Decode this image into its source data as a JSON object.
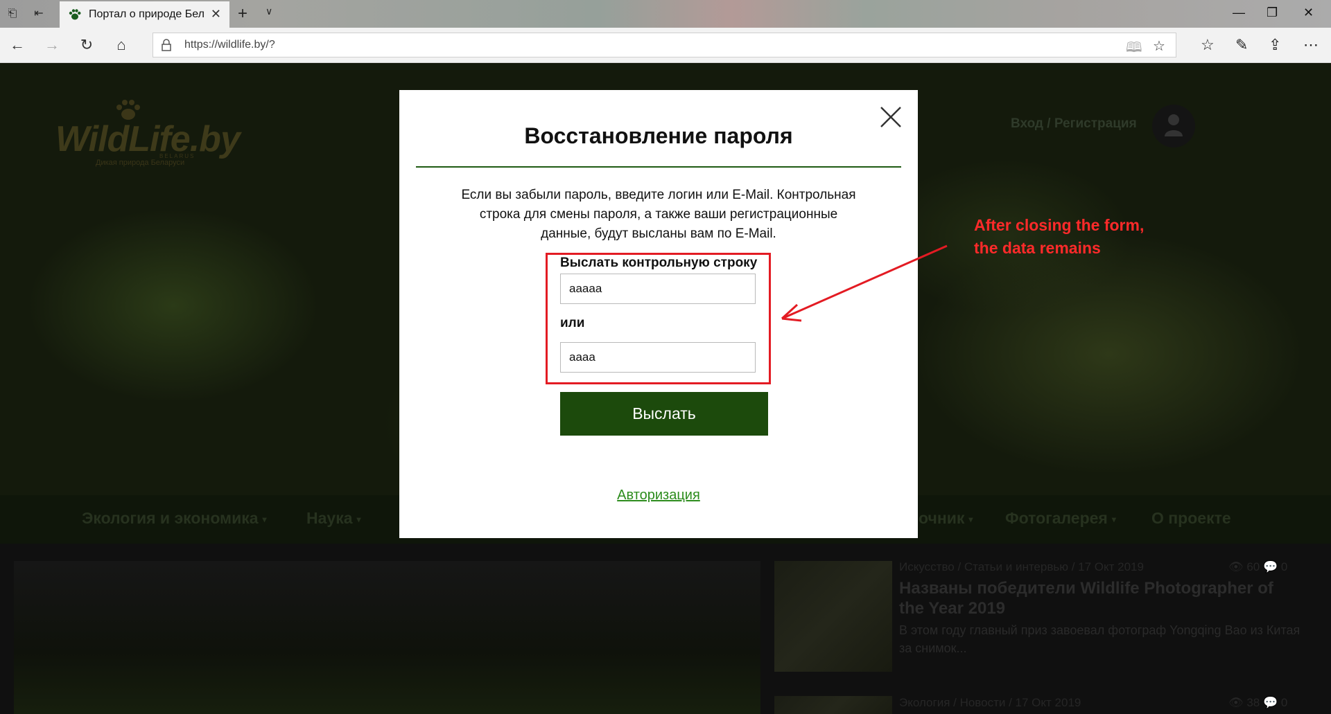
{
  "browser": {
    "tab_title": "Портал о природе Бел",
    "url": "https://wildlife.by/?"
  },
  "site": {
    "logo_text": "WildLife.by",
    "logo_subtitle": "Дикая природа Беларуси",
    "logo_country": "BELARUS",
    "login_link": "Вход / Регистрация",
    "menu": [
      "Экология и экономика",
      "Наука",
      "очник",
      "Фотогалерея",
      "О проекте"
    ],
    "cards": [
      {
        "meta": "Искусство / Статьи и интервью / 17 Окт 2019",
        "views": "60",
        "comments": "0",
        "title": "Названы победители Wildlife Photographer of the Year 2019",
        "text": "В этом году главный приз завоевал фотограф Yongqing Bao из Китая за снимок..."
      },
      {
        "meta": "Экология / Новости / 17 Окт 2019",
        "views": "38",
        "comments": "0"
      }
    ]
  },
  "modal": {
    "title": "Восстановление пароля",
    "description": "Если вы забыли пароль, введите логин или E-Mail. Контрольная строка для смены пароля, а также ваши регистрационные данные, будут высланы вам по E-Mail.",
    "send_label": "Выслать контрольную строку",
    "login_value": "aaaaa",
    "or_label": "или",
    "email_value": "aaaa",
    "submit_label": "Выслать",
    "auth_link": "Авторизация"
  },
  "annotation": {
    "line1": "After closing the form,",
    "line2": "the data remains",
    "color": "#e31b23"
  }
}
